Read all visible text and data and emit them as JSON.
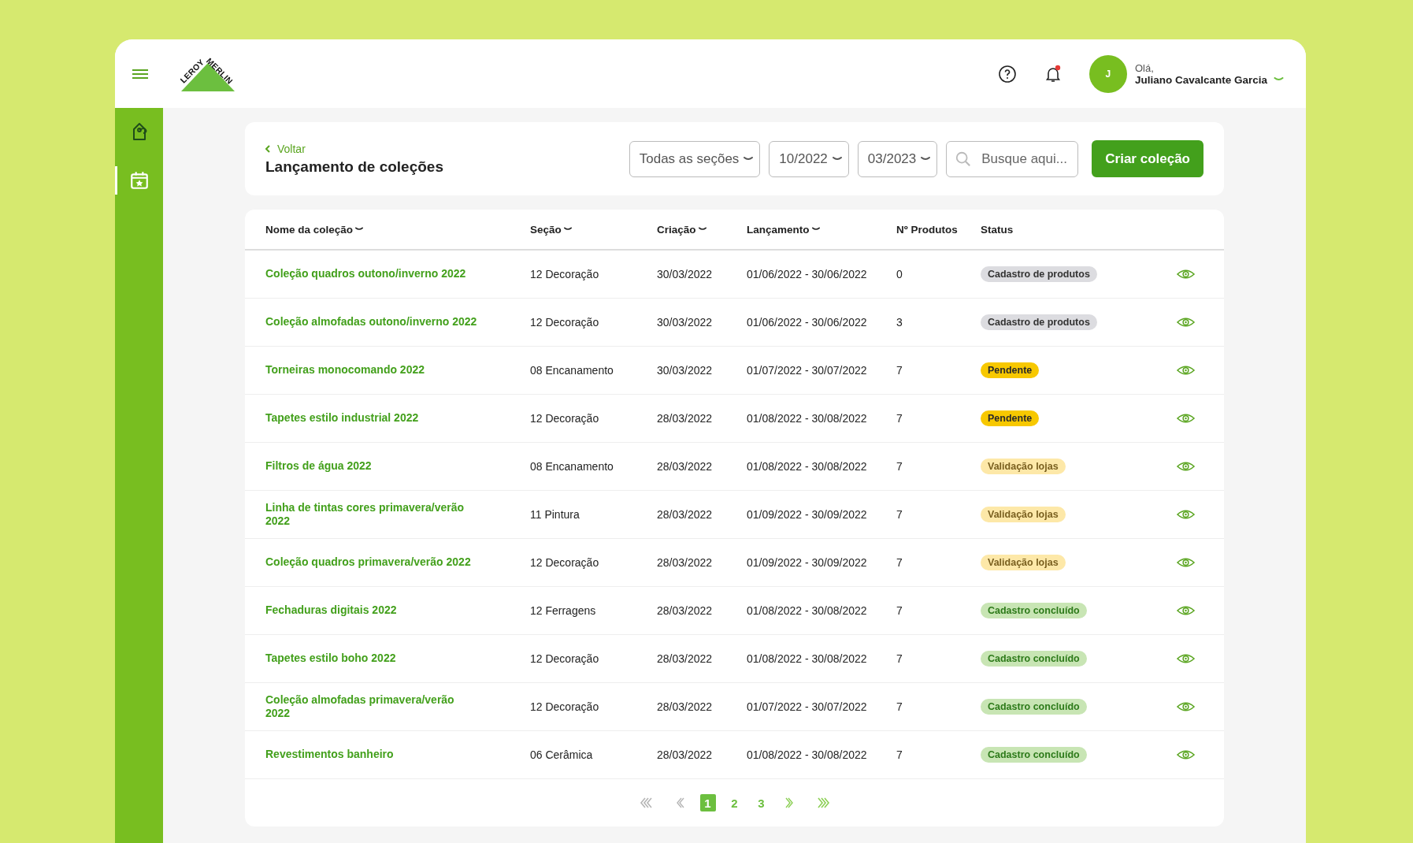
{
  "header": {
    "logo": [
      "LEROY",
      "MERLIN"
    ],
    "notifications": {
      "unread": true
    },
    "user": {
      "initial": "J",
      "greeting": "Olá,",
      "name": "Juliano Cavalcante Garcia"
    }
  },
  "sidebar": {
    "items": [
      {
        "kind": "tag",
        "selected": false
      },
      {
        "kind": "calendar",
        "selected": true
      }
    ]
  },
  "toolbar": {
    "back": "Voltar",
    "title": "Lançamento de coleções",
    "filters": [
      {
        "kind": "select",
        "value": "Todas as seções"
      },
      {
        "kind": "select",
        "value": "10/2022"
      },
      {
        "kind": "select",
        "value": "03/2023"
      },
      {
        "kind": "search",
        "placeholder": "Busque aqui..."
      }
    ],
    "create_button": "Criar coleção"
  },
  "table": {
    "columns": [
      {
        "label": "Nome da coleção",
        "sortable": true
      },
      {
        "label": "Seção",
        "sortable": true
      },
      {
        "label": "Criação",
        "sortable": true
      },
      {
        "label": "Lançamento",
        "sortable": true
      },
      {
        "label": "Nº Produtos",
        "sortable": false
      },
      {
        "label": "Status",
        "sortable": false
      }
    ],
    "rows": [
      {
        "name": "Coleção quadros outono/inverno 2022",
        "section": "12 Decoração",
        "created": "30/03/2022",
        "launch": "01/06/2022 - 30/06/2022",
        "products": "0",
        "status": {
          "label": "Cadastro de produtos",
          "kind": "registration"
        }
      },
      {
        "name": "Coleção almofadas outono/inverno 2022",
        "section": "12 Decoração",
        "created": "30/03/2022",
        "launch": "01/06/2022 - 30/06/2022",
        "products": "3",
        "status": {
          "label": "Cadastro de produtos",
          "kind": "registration"
        }
      },
      {
        "name": "Torneiras monocomando 2022",
        "section": "08 Encanamento",
        "created": "30/03/2022",
        "launch": "01/07/2022 - 30/07/2022",
        "products": "7",
        "status": {
          "label": "Pendente",
          "kind": "pending"
        }
      },
      {
        "name": "Tapetes estilo industrial 2022",
        "section": "12 Decoração",
        "created": "28/03/2022",
        "launch": "01/08/2022 - 30/08/2022",
        "products": "7",
        "status": {
          "label": "Pendente",
          "kind": "pending"
        }
      },
      {
        "name": "Filtros de água 2022",
        "section": "08 Encanamento",
        "created": "28/03/2022",
        "launch": "01/08/2022 - 30/08/2022",
        "products": "7",
        "status": {
          "label": "Validação lojas",
          "kind": "validation"
        }
      },
      {
        "name": "Linha de tintas cores primavera/verão 2022",
        "section": "11 Pintura",
        "created": "28/03/2022",
        "launch": "01/09/2022 - 30/09/2022",
        "products": "7",
        "status": {
          "label": "Validação lojas",
          "kind": "validation"
        }
      },
      {
        "name": "Coleção quadros primavera/verão 2022",
        "section": "12 Decoração",
        "created": "28/03/2022",
        "launch": "01/09/2022 - 30/09/2022",
        "products": "7",
        "status": {
          "label": "Validação lojas",
          "kind": "validation"
        }
      },
      {
        "name": "Fechaduras digitais 2022",
        "section": "12 Ferragens",
        "created": "28/03/2022",
        "launch": "01/08/2022 - 30/08/2022",
        "products": "7",
        "status": {
          "label": "Cadastro concluído",
          "kind": "done"
        }
      },
      {
        "name": "Tapetes estilo boho 2022",
        "section": "12 Decoração",
        "created": "28/03/2022",
        "launch": "01/08/2022 - 30/08/2022",
        "products": "7",
        "status": {
          "label": "Cadastro concluído",
          "kind": "done"
        }
      },
      {
        "name": "Coleção almofadas primavera/verão 2022",
        "section": "12 Decoração",
        "created": "28/03/2022",
        "launch": "01/07/2022 - 30/07/2022",
        "products": "7",
        "status": {
          "label": "Cadastro concluído",
          "kind": "done"
        }
      },
      {
        "name": "Revestimentos banheiro",
        "section": "06 Cerâmica",
        "created": "28/03/2022",
        "launch": "01/08/2022 - 30/08/2022",
        "products": "7",
        "status": {
          "label": "Cadastro concluído",
          "kind": "done"
        }
      }
    ]
  },
  "pagination": {
    "first": {
      "disabled": true
    },
    "prev": {
      "disabled": true
    },
    "pages": [
      {
        "label": "1",
        "selected": true
      },
      {
        "label": "2",
        "selected": false
      },
      {
        "label": "3",
        "selected": false
      }
    ],
    "next": {
      "disabled": false
    },
    "last": {
      "disabled": false
    }
  }
}
